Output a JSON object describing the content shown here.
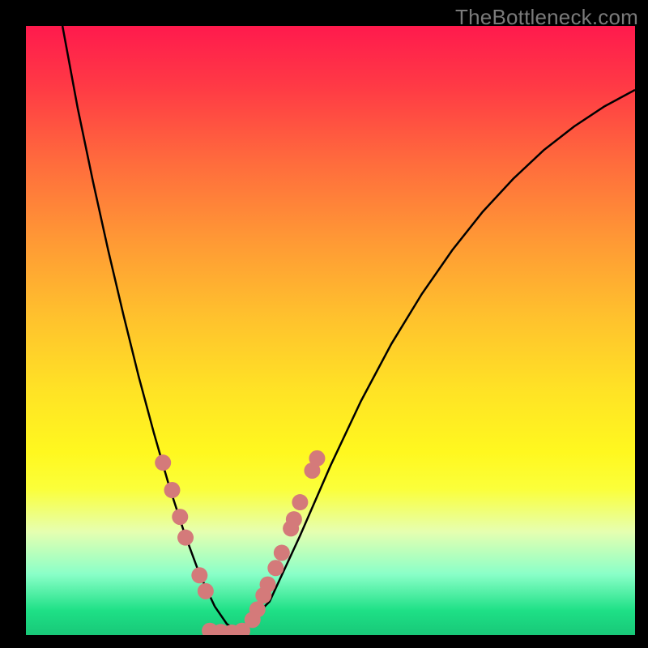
{
  "watermark": "TheBottleneck.com",
  "chart_data": {
    "type": "line",
    "title": "",
    "xlabel": "",
    "ylabel": "",
    "xlim": [
      0,
      1
    ],
    "ylim": [
      0,
      1
    ],
    "grid": false,
    "series": [
      {
        "name": "curve",
        "color": "#000000",
        "x": [
          0.06,
          0.085,
          0.11,
          0.135,
          0.16,
          0.185,
          0.21,
          0.235,
          0.26,
          0.285,
          0.31,
          0.33,
          0.35,
          0.4,
          0.45,
          0.5,
          0.55,
          0.6,
          0.65,
          0.7,
          0.75,
          0.8,
          0.85,
          0.9,
          0.95,
          1.0
        ],
        "y": [
          1.0,
          0.865,
          0.745,
          0.632,
          0.526,
          0.425,
          0.332,
          0.245,
          0.168,
          0.1,
          0.047,
          0.018,
          0.005,
          0.055,
          0.163,
          0.278,
          0.384,
          0.478,
          0.56,
          0.632,
          0.695,
          0.749,
          0.796,
          0.835,
          0.868,
          0.895
        ]
      }
    ],
    "markers": [
      {
        "x": 0.225,
        "y": 0.283
      },
      {
        "x": 0.24,
        "y": 0.238
      },
      {
        "x": 0.253,
        "y": 0.194
      },
      {
        "x": 0.262,
        "y": 0.16
      },
      {
        "x": 0.285,
        "y": 0.098
      },
      {
        "x": 0.295,
        "y": 0.072
      },
      {
        "x": 0.302,
        "y": 0.007
      },
      {
        "x": 0.32,
        "y": 0.005
      },
      {
        "x": 0.338,
        "y": 0.004
      },
      {
        "x": 0.355,
        "y": 0.007
      },
      {
        "x": 0.372,
        "y": 0.025
      },
      {
        "x": 0.38,
        "y": 0.042
      },
      {
        "x": 0.39,
        "y": 0.065
      },
      {
        "x": 0.397,
        "y": 0.083
      },
      {
        "x": 0.41,
        "y": 0.11
      },
      {
        "x": 0.42,
        "y": 0.135
      },
      {
        "x": 0.435,
        "y": 0.175
      },
      {
        "x": 0.44,
        "y": 0.19
      },
      {
        "x": 0.45,
        "y": 0.218
      },
      {
        "x": 0.47,
        "y": 0.27
      },
      {
        "x": 0.478,
        "y": 0.29
      }
    ],
    "marker_color": "#d47a7a",
    "marker_radius": 10
  }
}
